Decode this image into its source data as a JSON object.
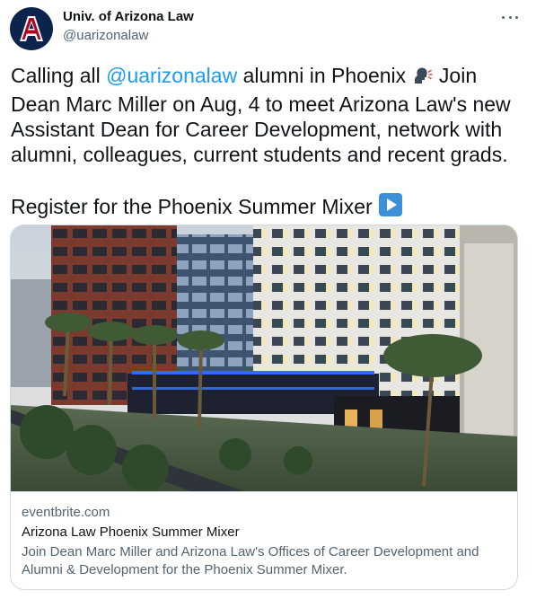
{
  "account": {
    "name": "Univ. of Arizona Law",
    "handle": "@uarizonalaw",
    "avatar_icon": "university-of-arizona-a-logo",
    "brand_navy": "#0c234b",
    "brand_red": "#ab0520"
  },
  "tweet": {
    "part1": "Calling all ",
    "mention": "@uarizonalaw",
    "part2": " alumni in Phoenix ",
    "emoji1": "speaking-head-icon",
    "part3": " Join Dean Marc Miller on Aug, 4 to meet Arizona Law's new Assistant Dean for Career Development, network with alumni, colleagues, current students and recent grads.\n\nRegister for the Phoenix Summer Mixer ",
    "emoji2": "play-button-icon"
  },
  "card": {
    "image_alt": "hotel-building-photo",
    "domain": "eventbrite.com",
    "title": "Arizona Law Phoenix Summer Mixer",
    "description": "Join Dean Marc Miller and Arizona Law's Offices of Career Development and Alumni & Development for the Phoenix Summer Mixer."
  },
  "colors": {
    "link": "#1d9bf0",
    "text": "#0f1419",
    "secondary": "#536471",
    "border": "#cfd9de"
  }
}
